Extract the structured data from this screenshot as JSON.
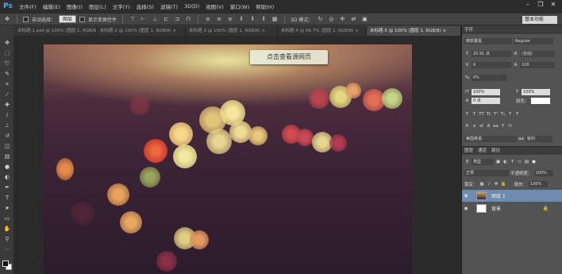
{
  "app": {
    "logo": "Ps"
  },
  "menu": [
    "文件(F)",
    "编辑(E)",
    "图像(I)",
    "图层(L)",
    "文字(Y)",
    "选择(S)",
    "滤镜(T)",
    "3D(D)",
    "视图(V)",
    "窗口(W)",
    "帮助(H)"
  ],
  "window_controls": {
    "minimize": "–",
    "restore": "❐",
    "close": "✕"
  },
  "options": {
    "auto_select_label": "自动选择：",
    "auto_select_value": "图层",
    "transform_label": "显示变换控件",
    "mode_3d_label": "3D 模式：",
    "workspace": "基本功能"
  },
  "tabs": [
    {
      "label": "未标题-1.psd @ 100% (图层 1, RGB/8) ×",
      "active": false
    },
    {
      "label": "未标题-2 @ 100% (图层 1, RGB/8) ×",
      "active": false
    },
    {
      "label": "未标题-3 @ 100% (图层 1, RGB/8) ×",
      "active": false
    },
    {
      "label": "未标题-4 @ 66.7% (图层 1, RGB/8) ×",
      "active": false
    },
    {
      "label": "未标题-5 @ 100% (图层 1, RGB/8) ×",
      "active": true
    }
  ],
  "canvas": {
    "watermark": "点击查看源网页"
  },
  "character_panel": {
    "header": "字符",
    "font_family": "微软雅黑",
    "font_style": "Regular",
    "font_size": "20.91 点",
    "leading": "(自动)",
    "kerning": "0",
    "tracking": "100",
    "scale_percent": "0%",
    "vertical_scale": "100%",
    "horizontal_scale": "100%",
    "baseline": "0 点",
    "color_label": "颜色：",
    "language": "美国英语",
    "anti_alias": "锐利"
  },
  "layers_panel": {
    "tabs": [
      "图层",
      "通道",
      "路径"
    ],
    "kind": "类型",
    "blend_mode": "正常",
    "opacity_label": "不透明度：",
    "opacity": "100%",
    "lock_label": "锁定：",
    "fill_label": "填充：",
    "fill": "100%",
    "layers": [
      {
        "name": "图层 1",
        "selected": true,
        "thumb": "photo"
      },
      {
        "name": "背景",
        "selected": false,
        "thumb": "white"
      }
    ]
  },
  "icons": {
    "move": "move-icon",
    "marquee": "marquee-icon",
    "lasso": "lasso-icon",
    "quick-select": "quick-select-icon",
    "crop": "crop-icon",
    "eyedropper": "eyedropper-icon",
    "heal": "heal-icon",
    "brush": "brush-icon",
    "stamp": "stamp-icon",
    "history": "history-brush-icon",
    "eraser": "eraser-icon",
    "gradient": "gradient-icon",
    "blur": "blur-icon",
    "dodge": "dodge-icon",
    "pen": "pen-icon",
    "type": "type-icon",
    "path-select": "path-select-icon",
    "shape": "shape-icon",
    "hand": "hand-icon",
    "zoom": "zoom-icon"
  },
  "colors": {
    "accent": "#4fa7f0",
    "selected_layer": "#6f8bb0"
  }
}
